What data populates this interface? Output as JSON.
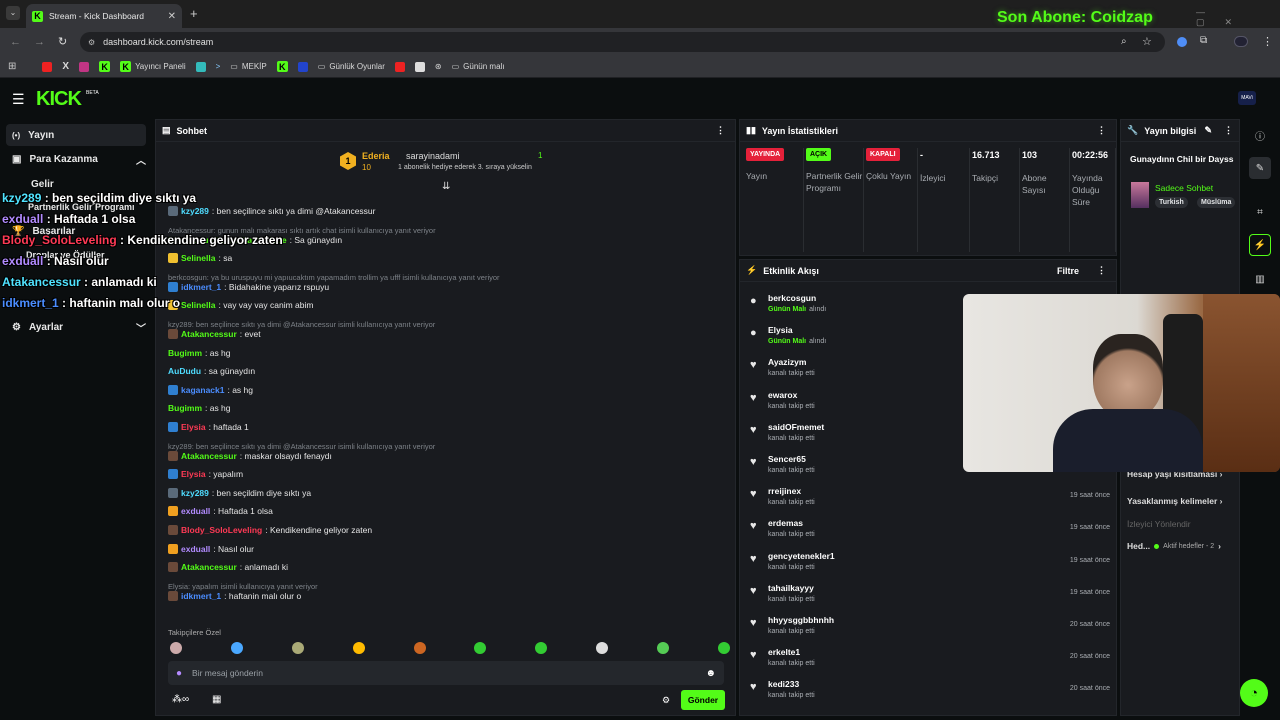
{
  "browser": {
    "tab_title": "Stream - Kick Dashboard",
    "url": "dashboard.kick.com/stream",
    "overlay_title": "Son Abone: Coidzap",
    "bookmarks": [
      "Yayıncı Paneli",
      "MEKİP",
      "Günlük Oyunlar",
      "Günün malı"
    ]
  },
  "nav": {
    "logo": "KICK",
    "beta": "BETA"
  },
  "sidebar": {
    "items": [
      "Yayın",
      "Para Kazanma",
      "Gelir",
      "Partnerlik Gelir Programı",
      "Başarılar",
      "Droplar ve Ödüller",
      "Ayarlar"
    ]
  },
  "overlay_chat": [
    {
      "user": "kzy289",
      "msg": " : ben seçildim diye sıktı ya",
      "color": "#50e3ff"
    },
    {
      "user": "exduall",
      "msg": " : Haftada 1 olsa",
      "color": "#b28bff"
    },
    {
      "user": "Blody_SoloLeveling",
      "msg": " : Kendikendine geliyor zaten",
      "color": "#ff3a55"
    },
    {
      "user": "exduall",
      "msg": " : Nasıl olur",
      "color": "#b28bff"
    },
    {
      "user": "Atakancessur",
      "msg": " : anlamadı ki",
      "color": "#50e3ff"
    },
    {
      "user": "idkmert_1",
      "msg": " : haftanin malı olur o",
      "color": "#4b8dff"
    }
  ],
  "chat": {
    "title": "Sohbet",
    "pinned": {
      "user": "Ederia",
      "count": "10",
      "target": "sarayinadami",
      "num": "1",
      "msg": "1 abonelik hediye ederek 3. sıraya yükselin"
    },
    "lines": [
      {
        "reply": "",
        "user": "kzy289",
        "msg": ": ben seçilince sıktı ya dimi @Atakancessur",
        "color": "#4fdcff",
        "badge": "#5a6a7a"
      },
      {
        "reply": "Atakancessur: gunun malı makarası sıktı artık chat isimli kullanıcıya yanıt veriyor",
        "user": "",
        "msg": "",
        "color": "",
        "badge": ""
      },
      {
        "reply": "",
        "user": "bira_yudumlayan_kaan_dede",
        "msg": ": Sa günaydın",
        "color": "#53fc18",
        "badge": ""
      },
      {
        "reply": "",
        "user": "Selinella",
        "msg": ": sa",
        "color": "#53fc18",
        "badge": "#f0c030"
      },
      {
        "reply": "berkcosgun: ya bu uruspuyu mi yapıucaktım yapamadım trollim ya ufff isimli kullanıcıya yanıt veriyor",
        "user": "",
        "msg": "",
        "color": "",
        "badge": ""
      },
      {
        "reply": "",
        "user": "idkmert_1",
        "msg": ": Bidahakine yaparız rspuyu",
        "color": "#4b8dff",
        "badge": "#2f7fd0"
      },
      {
        "reply": "",
        "user": "Selinella",
        "msg": ": vay vay vay canim abim",
        "color": "#53fc18",
        "badge": "#f0c030"
      },
      {
        "reply": "kzy289: ben seçilince sıktı ya dimi @Atakancessur isimli kullanıcıya yanıt veriyor",
        "user": "",
        "msg": "",
        "color": "",
        "badge": ""
      },
      {
        "reply": "",
        "user": "Atakancessur",
        "msg": ": evet",
        "color": "#53fc18",
        "badge": "#6a4a3a"
      },
      {
        "reply": "",
        "user": "Bugimm",
        "msg": ": as hg",
        "color": "#53fc18",
        "badge": ""
      },
      {
        "reply": "",
        "user": "AuDudu",
        "msg": ": sa günaydın",
        "color": "#4fdcff",
        "badge": ""
      },
      {
        "reply": "",
        "user": "kaganack1",
        "msg": ": as hg",
        "color": "#4b8dff",
        "badge": "#2f7fd0"
      },
      {
        "reply": "",
        "user": "Bugimm",
        "msg": ": as hg",
        "color": "#53fc18",
        "badge": ""
      },
      {
        "reply": "",
        "user": "Elysia",
        "msg": ": haftada 1",
        "color": "#ff3a55",
        "badge": "#2f7fd0"
      },
      {
        "reply": "kzy289: ben seçilince sıktı ya dimi @Atakancessur isimli kullanıcıya yanıt veriyor",
        "user": "",
        "msg": "",
        "color": "",
        "badge": ""
      },
      {
        "reply": "",
        "user": "Atakancessur",
        "msg": ": maskar olsaydı fenaydı",
        "color": "#53fc18",
        "badge": "#6a4a3a"
      },
      {
        "reply": "",
        "user": "Elysia",
        "msg": ": yapalım",
        "color": "#ff3a55",
        "badge": "#2f7fd0"
      },
      {
        "reply": "",
        "user": "kzy289",
        "msg": ": ben seçildim diye sıktı ya",
        "color": "#4fdcff",
        "badge": "#5a6a7a"
      },
      {
        "reply": "",
        "user": "exduall",
        "msg": ": Haftada 1 olsa",
        "color": "#b28bff",
        "badge": "#f0a020"
      },
      {
        "reply": "",
        "user": "Blody_SoloLeveling",
        "msg": ": Kendikendine geliyor zaten",
        "color": "#ff3a55",
        "badge": "#6a4a3a"
      },
      {
        "reply": "",
        "user": "exduall",
        "msg": ": Nasıl olur",
        "color": "#b28bff",
        "badge": "#f0a020"
      },
      {
        "reply": "",
        "user": "Atakancessur",
        "msg": ": anlamadı ki",
        "color": "#53fc18",
        "badge": "#6a4a3a"
      },
      {
        "reply": "Elysia: yapalım isimli kullanıcıya yanıt veriyor",
        "user": "",
        "msg": "",
        "color": "",
        "badge": ""
      },
      {
        "reply": "",
        "user": "idkmert_1",
        "msg": ": haftanin malı olur o",
        "color": "#4b8dff",
        "badge": "#6a4a3a"
      }
    ],
    "emote_label": "Takipçilere Özel",
    "input_placeholder": "Bir mesaj gönderin",
    "send": "Gönder"
  },
  "stats": {
    "title": "Yayın İstatistikleri",
    "cols": [
      {
        "badge": "YAYINDA",
        "badge_color": "#e5213a",
        "label": "Yayın"
      },
      {
        "badge": "AÇIK",
        "badge_color": "#53fc18",
        "label": "Partnerlik Gelir Programı"
      },
      {
        "badge": "KAPALI",
        "badge_color": "#e5213a",
        "label": "Çoklu Yayın"
      },
      {
        "value": "-",
        "label": "İzleyici"
      },
      {
        "value": "16.713",
        "label": "Takipçi"
      },
      {
        "value": "103",
        "label": "Abone Sayısı"
      },
      {
        "value": "00:22:56",
        "label": "Yayında Olduğu Süre"
      }
    ]
  },
  "info": {
    "title": "Yayın bilgisi",
    "stream_title": "Gunaydınn Chil bir Dayss",
    "category": "Sadece Sohbet",
    "tags": [
      "Turkish",
      "Müslüma"
    ],
    "links": [
      "Hesap yaşı kısıtlaması",
      "Yasaklanmış kelimeler",
      "İzleyici Yönlendir",
      "Hed..."
    ],
    "goal": "Aktif hedefler - 2"
  },
  "events": {
    "title": "Etkinlik Akışı",
    "filter": "Filtre",
    "items": [
      {
        "name": "berkcosgun",
        "sub": "alındı",
        "reward": "Günün Malı",
        "time": "",
        "type": "reward"
      },
      {
        "name": "Elysia",
        "sub": "alındı",
        "reward": "Günün Malı",
        "time": "",
        "type": "reward"
      },
      {
        "name": "Ayazizym",
        "sub": "kanalı takip etti",
        "reward": "",
        "time": "",
        "type": "follow"
      },
      {
        "name": "ewarox",
        "sub": "kanalı takip etti",
        "reward": "",
        "time": "",
        "type": "follow"
      },
      {
        "name": "saidOFmemet",
        "sub": "kanalı takip etti",
        "reward": "",
        "time": "",
        "type": "follow"
      },
      {
        "name": "Sencer65",
        "sub": "kanalı takip etti",
        "reward": "",
        "time": "",
        "type": "follow"
      },
      {
        "name": "rreijinex",
        "sub": "kanalı takip etti",
        "reward": "",
        "time": "19 saat önce",
        "type": "follow"
      },
      {
        "name": "erdemas",
        "sub": "kanalı takip etti",
        "reward": "",
        "time": "19 saat önce",
        "type": "follow"
      },
      {
        "name": "gencyetenekler1",
        "sub": "kanalı takip etti",
        "reward": "",
        "time": "19 saat önce",
        "type": "follow"
      },
      {
        "name": "tahailkayyy",
        "sub": "kanalı takip etti",
        "reward": "",
        "time": "19 saat önce",
        "type": "follow"
      },
      {
        "name": "hhyysggbbhnhh",
        "sub": "kanalı takip etti",
        "reward": "",
        "time": "20 saat önce",
        "type": "follow"
      },
      {
        "name": "erkelte1",
        "sub": "kanalı takip etti",
        "reward": "",
        "time": "20 saat önce",
        "type": "follow"
      },
      {
        "name": "kedi233",
        "sub": "kanalı takip etti",
        "reward": "",
        "time": "20 saat önce",
        "type": "follow"
      }
    ]
  }
}
